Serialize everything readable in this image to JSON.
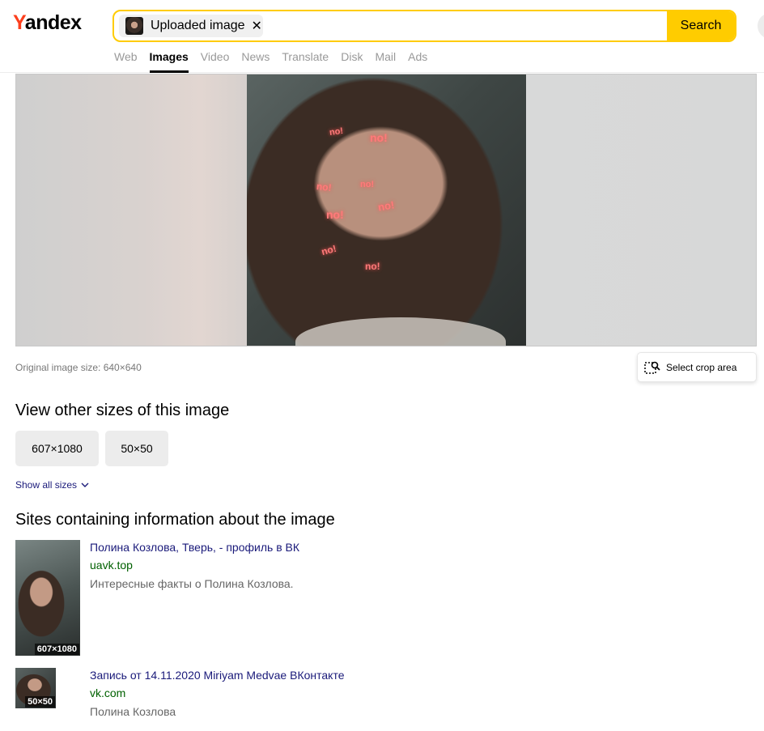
{
  "header": {
    "logo_first": "Y",
    "logo_rest": "andex",
    "chip_label": "Uploaded image",
    "chip_close": "✕",
    "search_label": "Search",
    "tabs": [
      {
        "label": "Web",
        "active": false
      },
      {
        "label": "Images",
        "active": true
      },
      {
        "label": "Video",
        "active": false
      },
      {
        "label": "News",
        "active": false
      },
      {
        "label": "Translate",
        "active": false
      },
      {
        "label": "Disk",
        "active": false
      },
      {
        "label": "Mail",
        "active": false
      },
      {
        "label": "Ads",
        "active": false
      }
    ]
  },
  "preview": {
    "overlay_word": "no!",
    "original_size": "Original image size: 640×640",
    "crop_label": "Select crop area"
  },
  "sizes": {
    "heading": "View other sizes of this image",
    "buttons": [
      "607×1080",
      "50×50"
    ],
    "show_all": "Show all sizes"
  },
  "sites": {
    "heading": "Sites containing information about the image",
    "results": [
      {
        "title": "Полина Козлова, Тверь, - профиль в ВК",
        "domain": "uavk.top",
        "description": "Интересные факты о Полина Козлова.",
        "badge": "607×1080"
      },
      {
        "title": "Запись от 14.11.2020 Miriyam Medvae ВКонтакте",
        "domain": "vk.com",
        "description": "Полина Козлова",
        "badge": "50×50"
      }
    ]
  },
  "colors": {
    "accent": "#ffcc00",
    "logo_red": "#fc3f1d",
    "link": "#1a1a7a",
    "domain": "#006000"
  }
}
